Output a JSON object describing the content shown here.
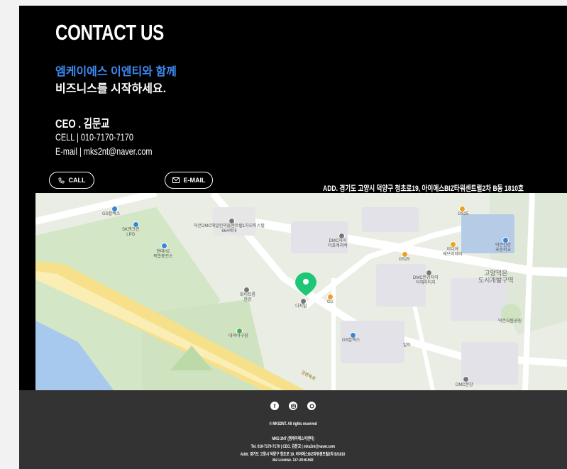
{
  "contact": {
    "title": "CONTACT US",
    "headline_blue": "엠케이에스 이엔티와 함께",
    "headline_white": "비즈니스를 시작하세요.",
    "ceo": "CEO . 김문교",
    "cell": "CELL |  010-7170-7170",
    "email": "E-mail | mks2nt@naver.com"
  },
  "buttons": {
    "call_label": "CALL",
    "call_icon": "phone-icon",
    "email_label": "E-MAIL",
    "email_icon": "mail-icon"
  },
  "address": "ADD. 경기도 고양시 덕양구 청초로19, 아이에스BIZ타워센트럴2차 B동 1810호",
  "map": {
    "labels": {
      "gs_store_top": "GS칼텍스",
      "sk_lpg": "SK엔크린\nLPG",
      "hydrogen": "현대H2\n복합충전소",
      "officetel": "덕은DMC에일린의뜰센트럴1차오피스텔\n664세대",
      "dmc_xi": "DMC자이\n더포레리버",
      "gs25_top": "GS25",
      "gs25_mid": "GS25",
      "ediya": "이디야\n에브리데이",
      "school": "덕은한강\n초등학교",
      "district": "고양덕은\n도시개발구역",
      "dmc_xi2": "DMC한강자이\n더헤리티지",
      "whiteroom": "화이트룸\n한강",
      "digital": "디지털",
      "cu": "CU",
      "gs_store_bottom": "GS칼텍스",
      "baseball": "대덕야구장",
      "park": "덕은으뜸공원",
      "dmc_bottom": "DMC한강",
      "mart": "알토",
      "road": "강변북로"
    },
    "marker_color": "#1ec776"
  },
  "footer": {
    "social_icons": [
      "facebook-icon",
      "instagram-icon",
      "blog-icon"
    ],
    "copyright": "© MKS2NT. All rights reserved",
    "company": "MKS 2NT (엠케이에스이엔티)",
    "tel_line": "Tel. 010-7170-7170 | CEO. 김문교 | mks2nt@naver.com",
    "addr_line": "Addr. 경기도 고양시 덕양구 청초로 19, 아이에스BIZ타워센트럴2차 B/1810",
    "license": "Biz License. 137-20-61592"
  },
  "colors": {
    "accent_blue": "#3d8bf6",
    "footer_bg": "#333333"
  }
}
